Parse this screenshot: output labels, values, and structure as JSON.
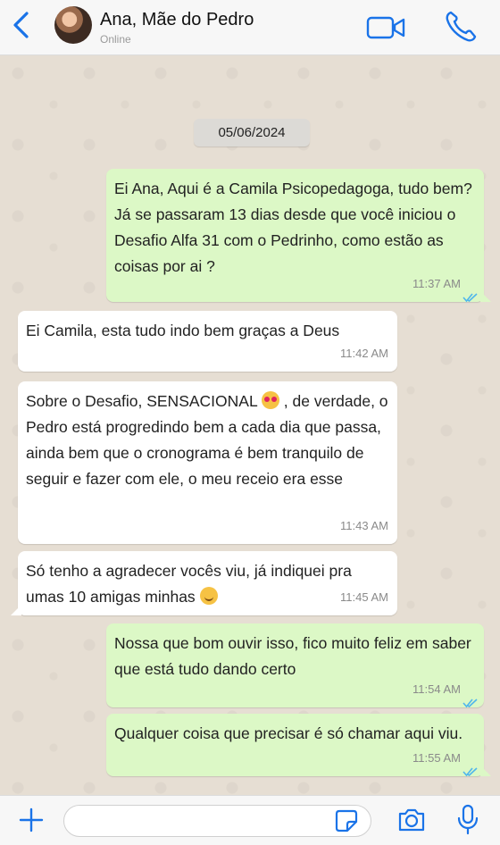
{
  "header": {
    "contact_name": "Ana, Mãe do Pedro",
    "status": "Online",
    "icons": [
      "back-arrow-icon",
      "video-call-icon",
      "phone-call-icon"
    ]
  },
  "chat": {
    "date_separator": "05/06/2024",
    "messages": [
      {
        "direction": "out",
        "text": "Ei Ana, Aqui é a Camila Psicopedagoga, tudo bem? Já se passaram 13 dias desde que você iniciou o Desafio Alfa 31 com o Pedrinho, como estão as coisas por ai ?",
        "time": "11:37 AM",
        "status": "read"
      },
      {
        "direction": "in",
        "text": "Ei Camila, esta tudo indo bem graças a Deus",
        "time": "11:42 AM"
      },
      {
        "direction": "in",
        "text_before_emoji": "Sobre o Desafio, SENSACIONAL ",
        "emoji": "heart-eyes-emoji",
        "text_after_emoji": " , de verdade, o Pedro está progredindo bem a cada dia que passa, ainda bem que o cronograma é bem tranquilo de seguir e fazer com ele, o meu receio era esse",
        "time": "11:43 AM"
      },
      {
        "direction": "in",
        "text_before_emoji": "Só tenho a agradecer vocês viu, já indiquei pra umas 10 amigas minhas ",
        "emoji": "smile-emoji",
        "time": "11:45 AM"
      },
      {
        "direction": "out",
        "text": "Nossa que bom ouvir isso, fico muito feliz em saber que está tudo dando certo",
        "time": "11:54 AM",
        "status": "read"
      },
      {
        "direction": "out",
        "text": "Qualquer coisa que precisar é só chamar aqui viu.",
        "time": "11:55 AM",
        "status": "read"
      }
    ]
  },
  "footer": {
    "input_value": "",
    "icons": [
      "plus-icon",
      "sticker-icon",
      "camera-icon",
      "microphone-icon"
    ]
  },
  "colors": {
    "accent": "#1a73e8",
    "outgoing_bubble": "#dcf8c6",
    "incoming_bubble": "#ffffff",
    "read_ticks": "#4fb6ec"
  }
}
